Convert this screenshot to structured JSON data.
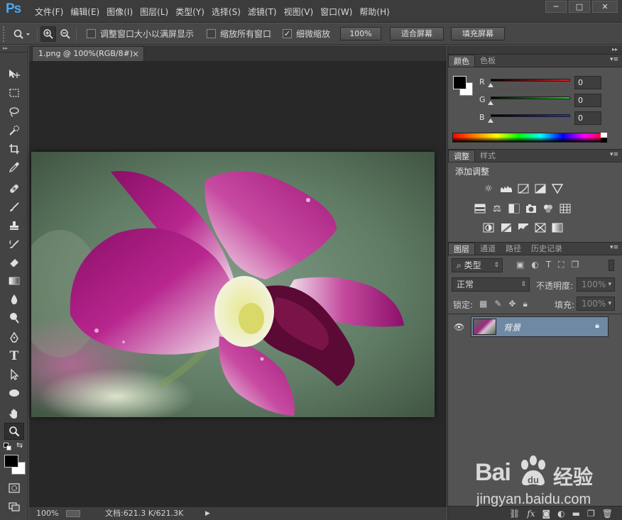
{
  "app": {
    "logo": "Ps",
    "menus": [
      "文件(F)",
      "编辑(E)",
      "图像(I)",
      "图层(L)",
      "类型(Y)",
      "选择(S)",
      "滤镜(T)",
      "视图(V)",
      "窗口(W)",
      "帮助(H)"
    ],
    "window_buttons": [
      "─",
      "□",
      "✕"
    ]
  },
  "options": {
    "checkboxes": [
      {
        "label": "调整窗口大小以满屏显示",
        "checked": false
      },
      {
        "label": "缩放所有窗口",
        "checked": false
      },
      {
        "label": "细微缩放",
        "checked": true
      }
    ],
    "buttons": [
      "100%",
      "适合屏幕",
      "填充屏幕"
    ]
  },
  "document": {
    "tab_title": "1.png @ 100%(RGB/8#)",
    "tab_close": "×"
  },
  "status": {
    "zoom": "100%",
    "doc_info": "文档:621.3 K/621.3K",
    "arrow": "▶"
  },
  "color_panel": {
    "tabs": [
      "颜色",
      "色板"
    ],
    "channels": [
      {
        "label": "R",
        "value": "0",
        "color": "#cc2020"
      },
      {
        "label": "G",
        "value": "0",
        "color": "#20cc20"
      },
      {
        "label": "B",
        "value": "0",
        "color": "#2020d0"
      }
    ],
    "foreground": "#000000",
    "background": "#ffffff"
  },
  "adjust_panel": {
    "tabs": [
      "调整",
      "样式"
    ],
    "title": "添加调整",
    "icons_row1": [
      "brightness-icon",
      "levels-icon",
      "curves-icon",
      "exposure-icon",
      "vibrance-icon"
    ],
    "icons_row2": [
      "hue-saturation-icon",
      "color-balance-icon",
      "black-white-icon",
      "photo-filter-icon",
      "channel-mixer-icon",
      "color-lookup-icon"
    ],
    "icons_row3": [
      "invert-icon",
      "posterize-icon",
      "threshold-icon",
      "selective-color-icon",
      "gradient-map-icon"
    ]
  },
  "layers_panel": {
    "tabs": [
      "图层",
      "通道",
      "路径",
      "历史记录"
    ],
    "filter_kind": "类型",
    "blend_mode": "正常",
    "opacity_label": "不透明度:",
    "opacity_value": "100%",
    "lock_label": "锁定:",
    "fill_label": "填充:",
    "fill_value": "100%",
    "layers": [
      {
        "name": "背景",
        "visible": true,
        "locked": true
      }
    ]
  },
  "watermark": {
    "brand_left": "Bai",
    "brand_right": "经验",
    "url": "jingyan.baidu.com"
  }
}
